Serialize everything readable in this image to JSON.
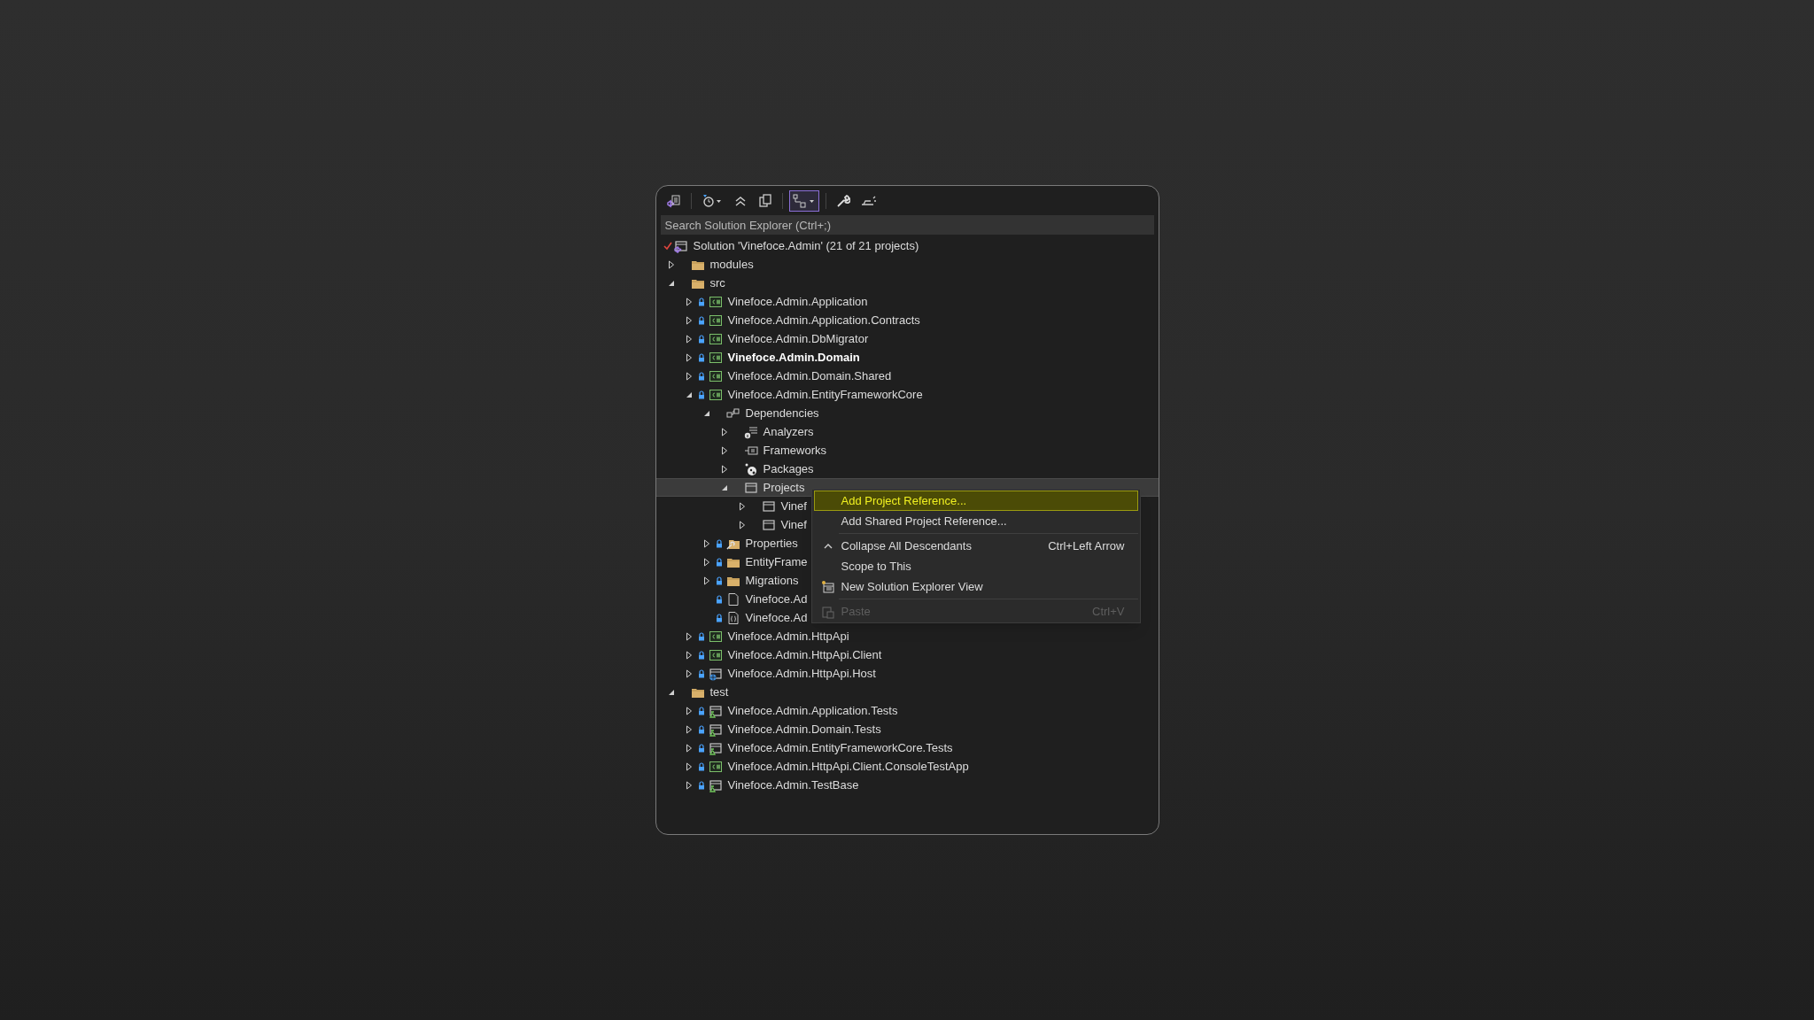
{
  "toolbar": [
    {
      "kind": "switch-views",
      "selected": false
    },
    {
      "kind": "separator"
    },
    {
      "kind": "pending-changes",
      "selected": false
    },
    {
      "kind": "collapse-all",
      "selected": false
    },
    {
      "kind": "show-all",
      "selected": false
    },
    {
      "kind": "separator"
    },
    {
      "kind": "sync",
      "selected": true
    },
    {
      "kind": "separator"
    },
    {
      "kind": "properties",
      "selected": false
    },
    {
      "kind": "preview",
      "selected": false
    }
  ],
  "search": {
    "placeholder": "Search Solution Explorer (Ctrl+;)"
  },
  "tree": [
    {
      "label": "Solution 'Vinefoce.Admin' (21 of 21 projects)",
      "kind": "solution",
      "bold": false,
      "selected": false
    },
    {
      "label": "modules",
      "kind": "folder",
      "expanded": false,
      "locked": false,
      "bold": false,
      "selected": false
    },
    {
      "label": "src",
      "kind": "folder",
      "expanded": true,
      "locked": false,
      "bold": false,
      "selected": false,
      "children": [
        {
          "label": "Vinefoce.Admin.Application",
          "kind": "csharp",
          "expanded": false,
          "locked": true,
          "bold": false,
          "selected": false
        },
        {
          "label": "Vinefoce.Admin.Application.Contracts",
          "kind": "csharp",
          "expanded": false,
          "locked": true,
          "bold": false,
          "selected": false
        },
        {
          "label": "Vinefoce.Admin.DbMigrator",
          "kind": "csharp",
          "expanded": false,
          "locked": true,
          "bold": false,
          "selected": false
        },
        {
          "label": "Vinefoce.Admin.Domain",
          "kind": "csharp",
          "expanded": false,
          "locked": true,
          "bold": true,
          "selected": false
        },
        {
          "label": "Vinefoce.Admin.Domain.Shared",
          "kind": "csharp",
          "expanded": false,
          "locked": true,
          "bold": false,
          "selected": false
        },
        {
          "label": "Vinefoce.Admin.EntityFrameworkCore",
          "kind": "csharp",
          "expanded": true,
          "locked": true,
          "bold": false,
          "selected": false,
          "children": [
            {
              "label": "Dependencies",
              "kind": "deps",
              "expanded": true,
              "locked": false,
              "bold": false,
              "selected": false,
              "children": [
                {
                  "label": "Analyzers",
                  "kind": "analyzers",
                  "expanded": false,
                  "locked": false,
                  "bold": false,
                  "selected": false
                },
                {
                  "label": "Frameworks",
                  "kind": "frameworks",
                  "expanded": false,
                  "locked": false,
                  "bold": false,
                  "selected": false
                },
                {
                  "label": "Packages",
                  "kind": "packages",
                  "expanded": false,
                  "locked": false,
                  "bold": false,
                  "selected": false
                },
                {
                  "label": "Projects",
                  "kind": "projref",
                  "expanded": true,
                  "locked": false,
                  "bold": false,
                  "selected": true,
                  "children": [
                    {
                      "label": "Vinef",
                      "kind": "projref",
                      "expanded": false,
                      "locked": false,
                      "bold": false,
                      "selected": false
                    },
                    {
                      "label": "Vinef",
                      "kind": "projref",
                      "expanded": false,
                      "locked": false,
                      "bold": false,
                      "selected": false
                    }
                  ]
                }
              ]
            },
            {
              "label": "Properties",
              "kind": "propfolder",
              "expanded": false,
              "locked": true,
              "bold": false,
              "selected": false
            },
            {
              "label": "EntityFrame",
              "kind": "folder",
              "expanded": false,
              "locked": true,
              "bold": false,
              "selected": false
            },
            {
              "label": "Migrations",
              "kind": "folder",
              "expanded": false,
              "locked": true,
              "bold": false,
              "selected": false
            },
            {
              "label": "Vinefoce.Ad",
              "kind": "file",
              "locked": true,
              "bold": false,
              "selected": false
            },
            {
              "label": "Vinefoce.Ad",
              "kind": "json",
              "locked": true,
              "bold": false,
              "selected": false
            }
          ]
        },
        {
          "label": "Vinefoce.Admin.HttpApi",
          "kind": "csharp",
          "expanded": false,
          "locked": true,
          "bold": false,
          "selected": false
        },
        {
          "label": "Vinefoce.Admin.HttpApi.Client",
          "kind": "csharp",
          "expanded": false,
          "locked": true,
          "bold": false,
          "selected": false
        },
        {
          "label": "Vinefoce.Admin.HttpApi.Host",
          "kind": "web",
          "expanded": false,
          "locked": true,
          "bold": false,
          "selected": false
        }
      ]
    },
    {
      "label": "test",
      "kind": "folder",
      "expanded": true,
      "locked": false,
      "bold": false,
      "selected": false,
      "children": [
        {
          "label": "Vinefoce.Admin.Application.Tests",
          "kind": "test",
          "expanded": false,
          "locked": true,
          "bold": false,
          "selected": false
        },
        {
          "label": "Vinefoce.Admin.Domain.Tests",
          "kind": "test",
          "expanded": false,
          "locked": true,
          "bold": false,
          "selected": false
        },
        {
          "label": "Vinefoce.Admin.EntityFrameworkCore.Tests",
          "kind": "test",
          "expanded": false,
          "locked": true,
          "bold": false,
          "selected": false
        },
        {
          "label": "Vinefoce.Admin.HttpApi.Client.ConsoleTestApp",
          "kind": "csharp",
          "expanded": false,
          "locked": true,
          "bold": false,
          "selected": false
        },
        {
          "label": "Vinefoce.Admin.TestBase",
          "kind": "test",
          "expanded": false,
          "locked": true,
          "bold": false,
          "selected": false
        }
      ]
    }
  ],
  "context_menu": [
    {
      "kind": "plain",
      "label": "Add Project Reference...",
      "selected": true,
      "disabled": false
    },
    {
      "kind": "plain",
      "label": "Add Shared Project Reference...",
      "selected": false,
      "disabled": false
    },
    {
      "kind": "separator"
    },
    {
      "kind": "collapse",
      "label": "Collapse All Descendants",
      "shortcut": "Ctrl+Left Arrow",
      "selected": false,
      "disabled": false
    },
    {
      "kind": "plain",
      "label": "Scope to This",
      "selected": false,
      "disabled": false
    },
    {
      "kind": "new-view",
      "label": "New Solution Explorer View",
      "selected": false,
      "disabled": false
    },
    {
      "kind": "separator"
    },
    {
      "kind": "paste",
      "label": "Paste",
      "shortcut": "Ctrl+V",
      "selected": false,
      "disabled": true
    }
  ]
}
